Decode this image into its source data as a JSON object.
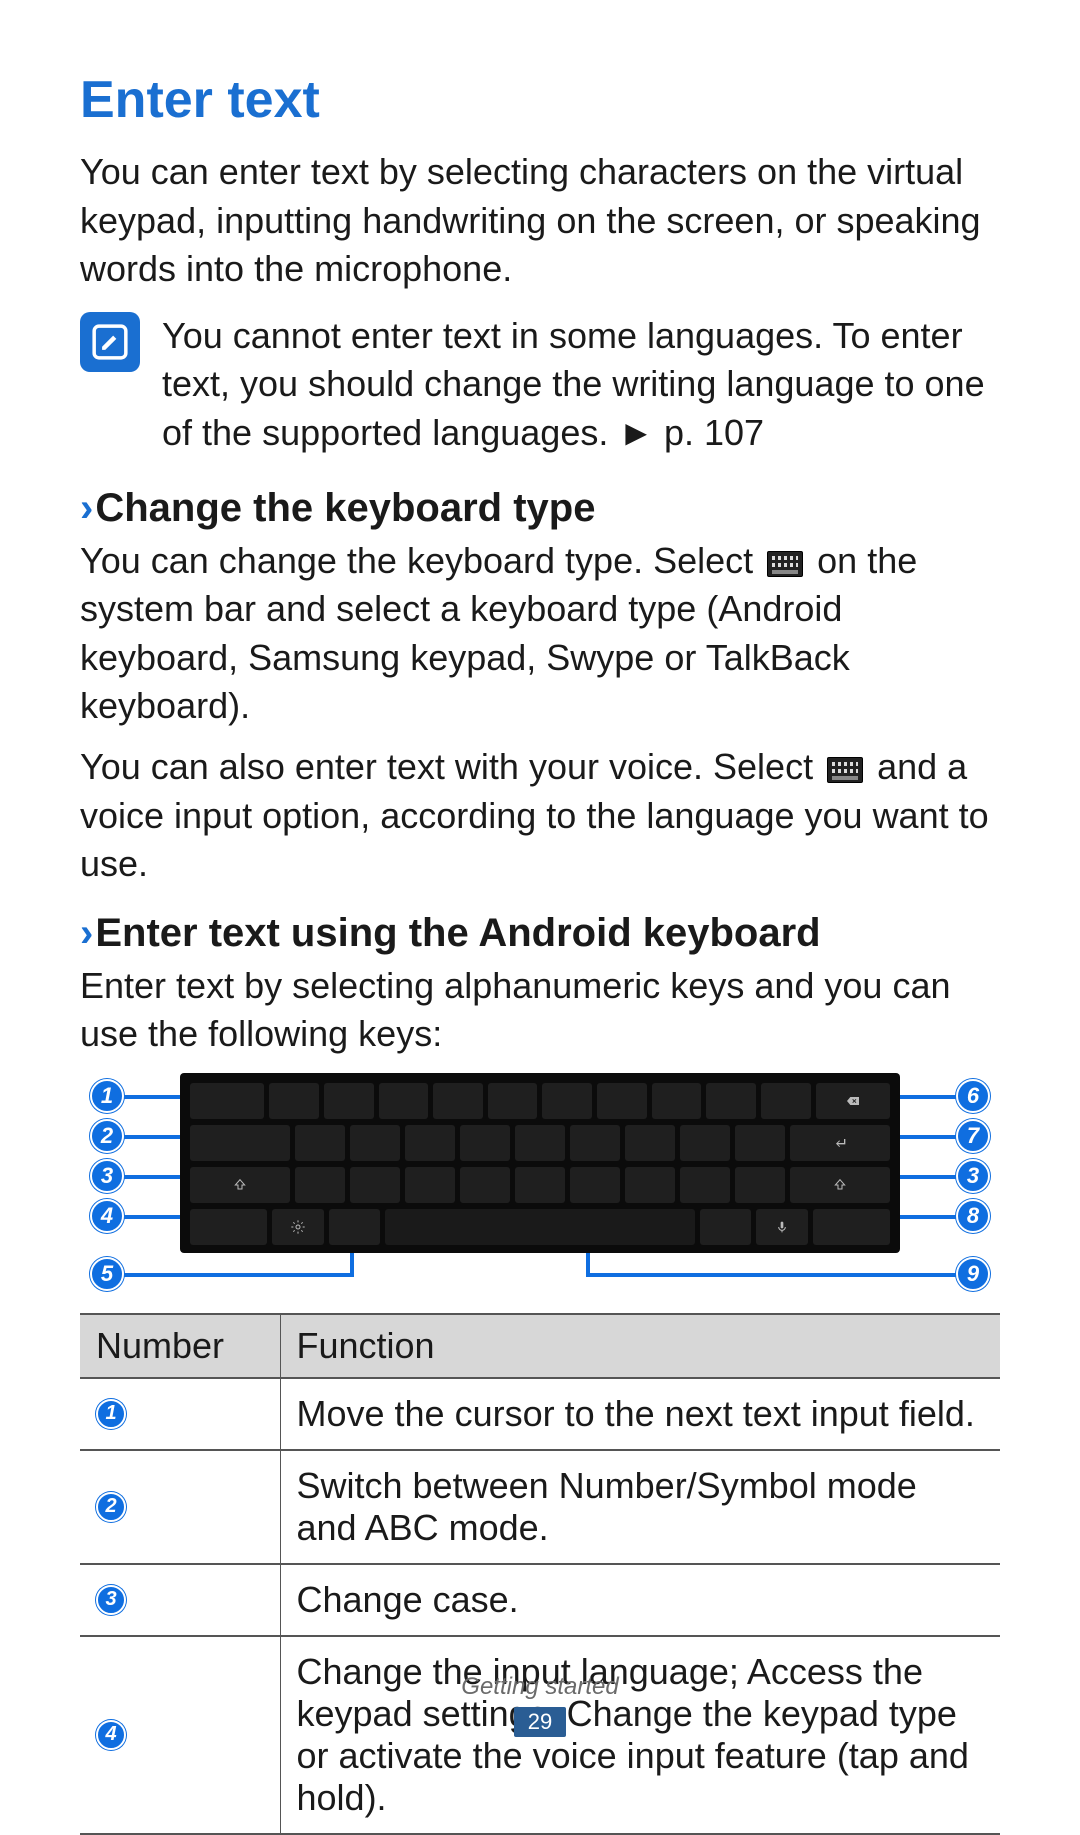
{
  "title": "Enter text",
  "intro": "You can enter text by selecting characters on the virtual keypad, inputting handwriting on the screen, or speaking words into the microphone.",
  "note": {
    "icon_name": "note-info-icon",
    "text": "You cannot enter text in some languages. To enter text, you should change the writing language to one of the supported languages. ► p. 107"
  },
  "sections": [
    {
      "heading": "Change the keyboard type",
      "paragraphs": [
        {
          "pre": "You can change the keyboard type. Select ",
          "icon": "keyboard-icon",
          "post": " on the system bar and select a keyboard type (Android keyboard, Samsung keypad, Swype or TalkBack keyboard)."
        },
        {
          "pre": "You can also enter text with your voice. Select ",
          "icon": "keyboard-icon",
          "post": " and a voice input option, according to the language you want to use."
        }
      ]
    },
    {
      "heading": "Enter text using the Android keyboard",
      "paragraphs": [
        {
          "pre": "Enter text by selecting alphanumeric keys and you can use the following keys:",
          "icon": null,
          "post": ""
        }
      ]
    }
  ],
  "keyboard_callouts": {
    "left": [
      "1",
      "2",
      "3",
      "4",
      "5"
    ],
    "right": [
      "6",
      "7",
      "3",
      "8",
      "9"
    ]
  },
  "table": {
    "headers": [
      "Number",
      "Function"
    ],
    "rows": [
      {
        "num": "1",
        "func": "Move the cursor to the next text input field."
      },
      {
        "num": "2",
        "func": "Switch between Number/Symbol mode and ABC mode."
      },
      {
        "num": "3",
        "func": "Change case."
      },
      {
        "num": "4",
        "func": "Change the input language; Access the keypad settings; Change the keypad type or activate the voice input feature (tap and hold)."
      }
    ]
  },
  "footer": {
    "section": "Getting started",
    "page": "29"
  }
}
